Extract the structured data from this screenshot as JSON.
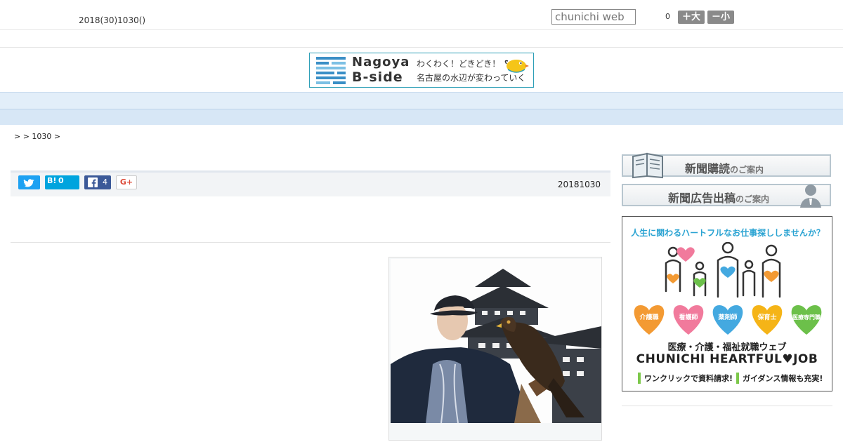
{
  "header": {
    "date": "2018(30)1030()",
    "search_placeholder": "chunichi web",
    "counter": "0",
    "font_large_label": "＋大",
    "font_small_label": "－小"
  },
  "banner": {
    "title_line1": "Nagoya",
    "title_line2": "B-side",
    "tagline1": "わくわく！どきどき！",
    "tagline2": "名古屋の水辺が変わっていく"
  },
  "nav": {
    "items": [
      "",
      "",
      "",
      "",
      "",
      "",
      "",
      "",
      ""
    ]
  },
  "breadcrumb": {
    "text": ">  > 1030 >"
  },
  "share": {
    "hatena_label": "B!",
    "hatena_count": "0",
    "facebook_count": "4",
    "gplus_label": "G+",
    "article_date": "20181030"
  },
  "sidebar": {
    "subscribe_main": "新聞購読",
    "subscribe_sub": "のご案内",
    "ad_main": "新聞広告出稿",
    "ad_sub": "のご案内",
    "job_ad": {
      "headline": "人生に関わるハートフルなお仕事探ししませんか？",
      "hearts": [
        "介護職",
        "看護師",
        "薬剤師",
        "保育士",
        "医療専門職"
      ],
      "subtitle": "医療・介護・福祉就職ウェブ",
      "brand": "CHUNICHI HEARTFUL♥JOB",
      "foot1": "ワンクリックで資料請求!",
      "foot2": "ガイダンス情報も充実!"
    }
  },
  "colors": {
    "nav_bg": "#e2eef9",
    "twitter": "#1da1f2",
    "hatena": "#00a4de",
    "facebook": "#3b5998",
    "ad_heart_colors": [
      "#f39a33",
      "#f17a9c",
      "#44a9e0",
      "#f5b417",
      "#6cc04a"
    ]
  }
}
